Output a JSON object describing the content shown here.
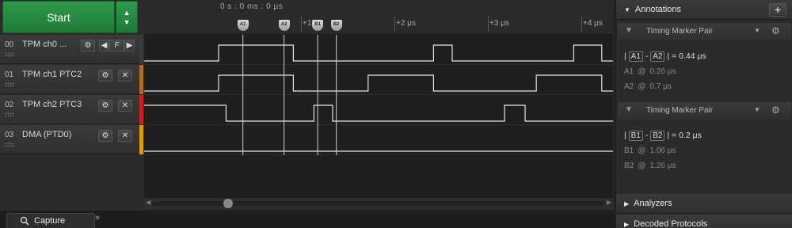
{
  "capture": {
    "start_label": "Start",
    "arrow_up": "▲",
    "arrow_down": "▼"
  },
  "channels": [
    {
      "num": "00",
      "name": "TPM ch0 ...",
      "color": "#3a3a3a",
      "btns": [
        "⚙",
        "◀",
        "F",
        "▶"
      ]
    },
    {
      "num": "01",
      "name": "TPM ch1 PTC2",
      "color": "#b06a26",
      "btns": [
        "⚙",
        "✕"
      ]
    },
    {
      "num": "02",
      "name": "TPM ch2 PTC3",
      "color": "#cc2020",
      "btns": [
        "⚙",
        "✕"
      ]
    },
    {
      "num": "03",
      "name": "DMA (PTD0)",
      "color": "#e09a10",
      "btns": [
        "⚙",
        "✕"
      ]
    }
  ],
  "timeline": {
    "origin": "0 s : 0 ms : 0 μs",
    "ticks": [
      {
        "label": "+1 μs",
        "us": 1
      },
      {
        "label": "+2 μs",
        "us": 2
      },
      {
        "label": "+3 μs",
        "us": 3
      },
      {
        "label": "+4 μs",
        "us": 4
      }
    ],
    "markers": [
      {
        "label": "A1",
        "us": 0.26
      },
      {
        "label": "A2",
        "us": 0.7
      },
      {
        "label": "B1",
        "us": 1.06
      },
      {
        "label": "B2",
        "us": 1.26
      }
    ]
  },
  "waveforms": [
    {
      "channel": "00",
      "edges_us": [
        0,
        0.8,
        2.3,
        2.5,
        3.8,
        4.1
      ],
      "start": 0
    },
    {
      "channel": "01",
      "edges_us": [
        0,
        0.8,
        1.6,
        2.3,
        3.4,
        4.1
      ],
      "start": 0
    },
    {
      "channel": "02",
      "edges_us": [
        0.08,
        1.02,
        1.22,
        3.06,
        3.28,
        4.34
      ],
      "start": 1
    },
    {
      "channel": "03",
      "edges_us": [],
      "start": 0
    }
  ],
  "bottom": {
    "tab_label": "Capture",
    "tab_icon": "search-icon",
    "more": "»"
  },
  "annotations": {
    "title": "Annotations",
    "add": "+",
    "pairs": [
      {
        "title": "Timing Marker Pair",
        "m1": "A1",
        "m2": "A2",
        "eq": "= 0.44 μs",
        "r1": {
          "name": "A1",
          "value": "0.26 μs"
        },
        "r2": {
          "name": "A2",
          "value": "0.7 μs"
        }
      },
      {
        "title": "Timing Marker Pair",
        "m1": "B1",
        "m2": "B2",
        "eq": "= 0.2 μs",
        "r1": {
          "name": "B1",
          "value": "1.06 μs"
        },
        "r2": {
          "name": "B2",
          "value": "1.26 μs"
        }
      }
    ]
  },
  "sections": {
    "analyzers": "Analyzers",
    "decoded": "Decoded Protocols"
  }
}
